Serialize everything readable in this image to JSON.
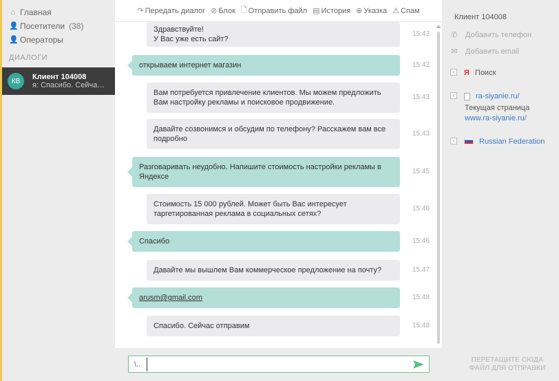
{
  "nav": {
    "home": "Главная",
    "visitors": "Посетители",
    "visitors_count": "(38)",
    "operators": "Операторы",
    "section_dialogs": "ДИАЛОГИ"
  },
  "dialog": {
    "avatar": "КВ",
    "name": "Клиент 104008",
    "preview": "я: Спасибо. Сейчас отправим"
  },
  "toolbar": {
    "transfer": "Передать диалог",
    "block": "Блок",
    "send_file": "Отправить файл",
    "history": "История",
    "pointer": "Указка",
    "spam": "Спам"
  },
  "messages": [
    {
      "dir": "out",
      "lines": [
        "Здравствуйте!",
        "У Вас уже есть сайт?"
      ],
      "time": "15:42"
    },
    {
      "dir": "in",
      "lines": [
        "открываем интернет магазин"
      ],
      "time": "15:42"
    },
    {
      "dir": "out",
      "lines": [
        "Вам потребуется привлечение клиентов. Мы можем предложить",
        "Вам настройку рекламы и поисковое продвижение."
      ],
      "time": "15:43"
    },
    {
      "dir": "out",
      "lines": [
        "Давайте созвонимся и обсудим по телефону? Расскажем вам все",
        "подробно"
      ],
      "time": "15:43"
    },
    {
      "dir": "in",
      "lines": [
        "Разговаривать неудобно. Напишите стоимость настройки рекламы в",
        "Яндексе"
      ],
      "time": "15:45"
    },
    {
      "dir": "out",
      "lines": [
        "Стоимость 15 000 рублей. Может быть Вас интересует",
        "таргетированная реклама в социальных сетях?"
      ],
      "time": "15:46"
    },
    {
      "dir": "in",
      "lines": [
        "Спасибо"
      ],
      "time": "15:46"
    },
    {
      "dir": "out",
      "lines": [
        "Давайте мы вышлем Вам коммерческое предложение на почту?"
      ],
      "time": "15:47"
    },
    {
      "dir": "in",
      "lines": [
        "arusm@gmail.com"
      ],
      "time": "15:48"
    },
    {
      "dir": "out",
      "lines": [
        "Спасибо. Сейчас отправим"
      ],
      "time": "15:48"
    }
  ],
  "input": {
    "attach": "\\..",
    "value": ""
  },
  "drop_hint": {
    "line1": "ПЕРЕТАЩИТЕ СЮДА",
    "line2": "ФАЙЛ ДЛЯ ОТПРАВКИ"
  },
  "right_panel": {
    "title": "Клиент 104008",
    "add_phone": "Добавить телефон",
    "add_email": "Добавить email",
    "source": "Поиск",
    "site": "ra-siyanie.ru/",
    "current_page_label": "Текущая страница",
    "current_page": "www.ra-siyanie.ru/",
    "country": "Russian Federation"
  },
  "colors": {
    "incoming_bubble": "#b4ded8",
    "outgoing_bubble": "#ebebed",
    "avatar": "#3aa79c",
    "link": "#3b7bc9",
    "input_border": "#6cc58e"
  }
}
